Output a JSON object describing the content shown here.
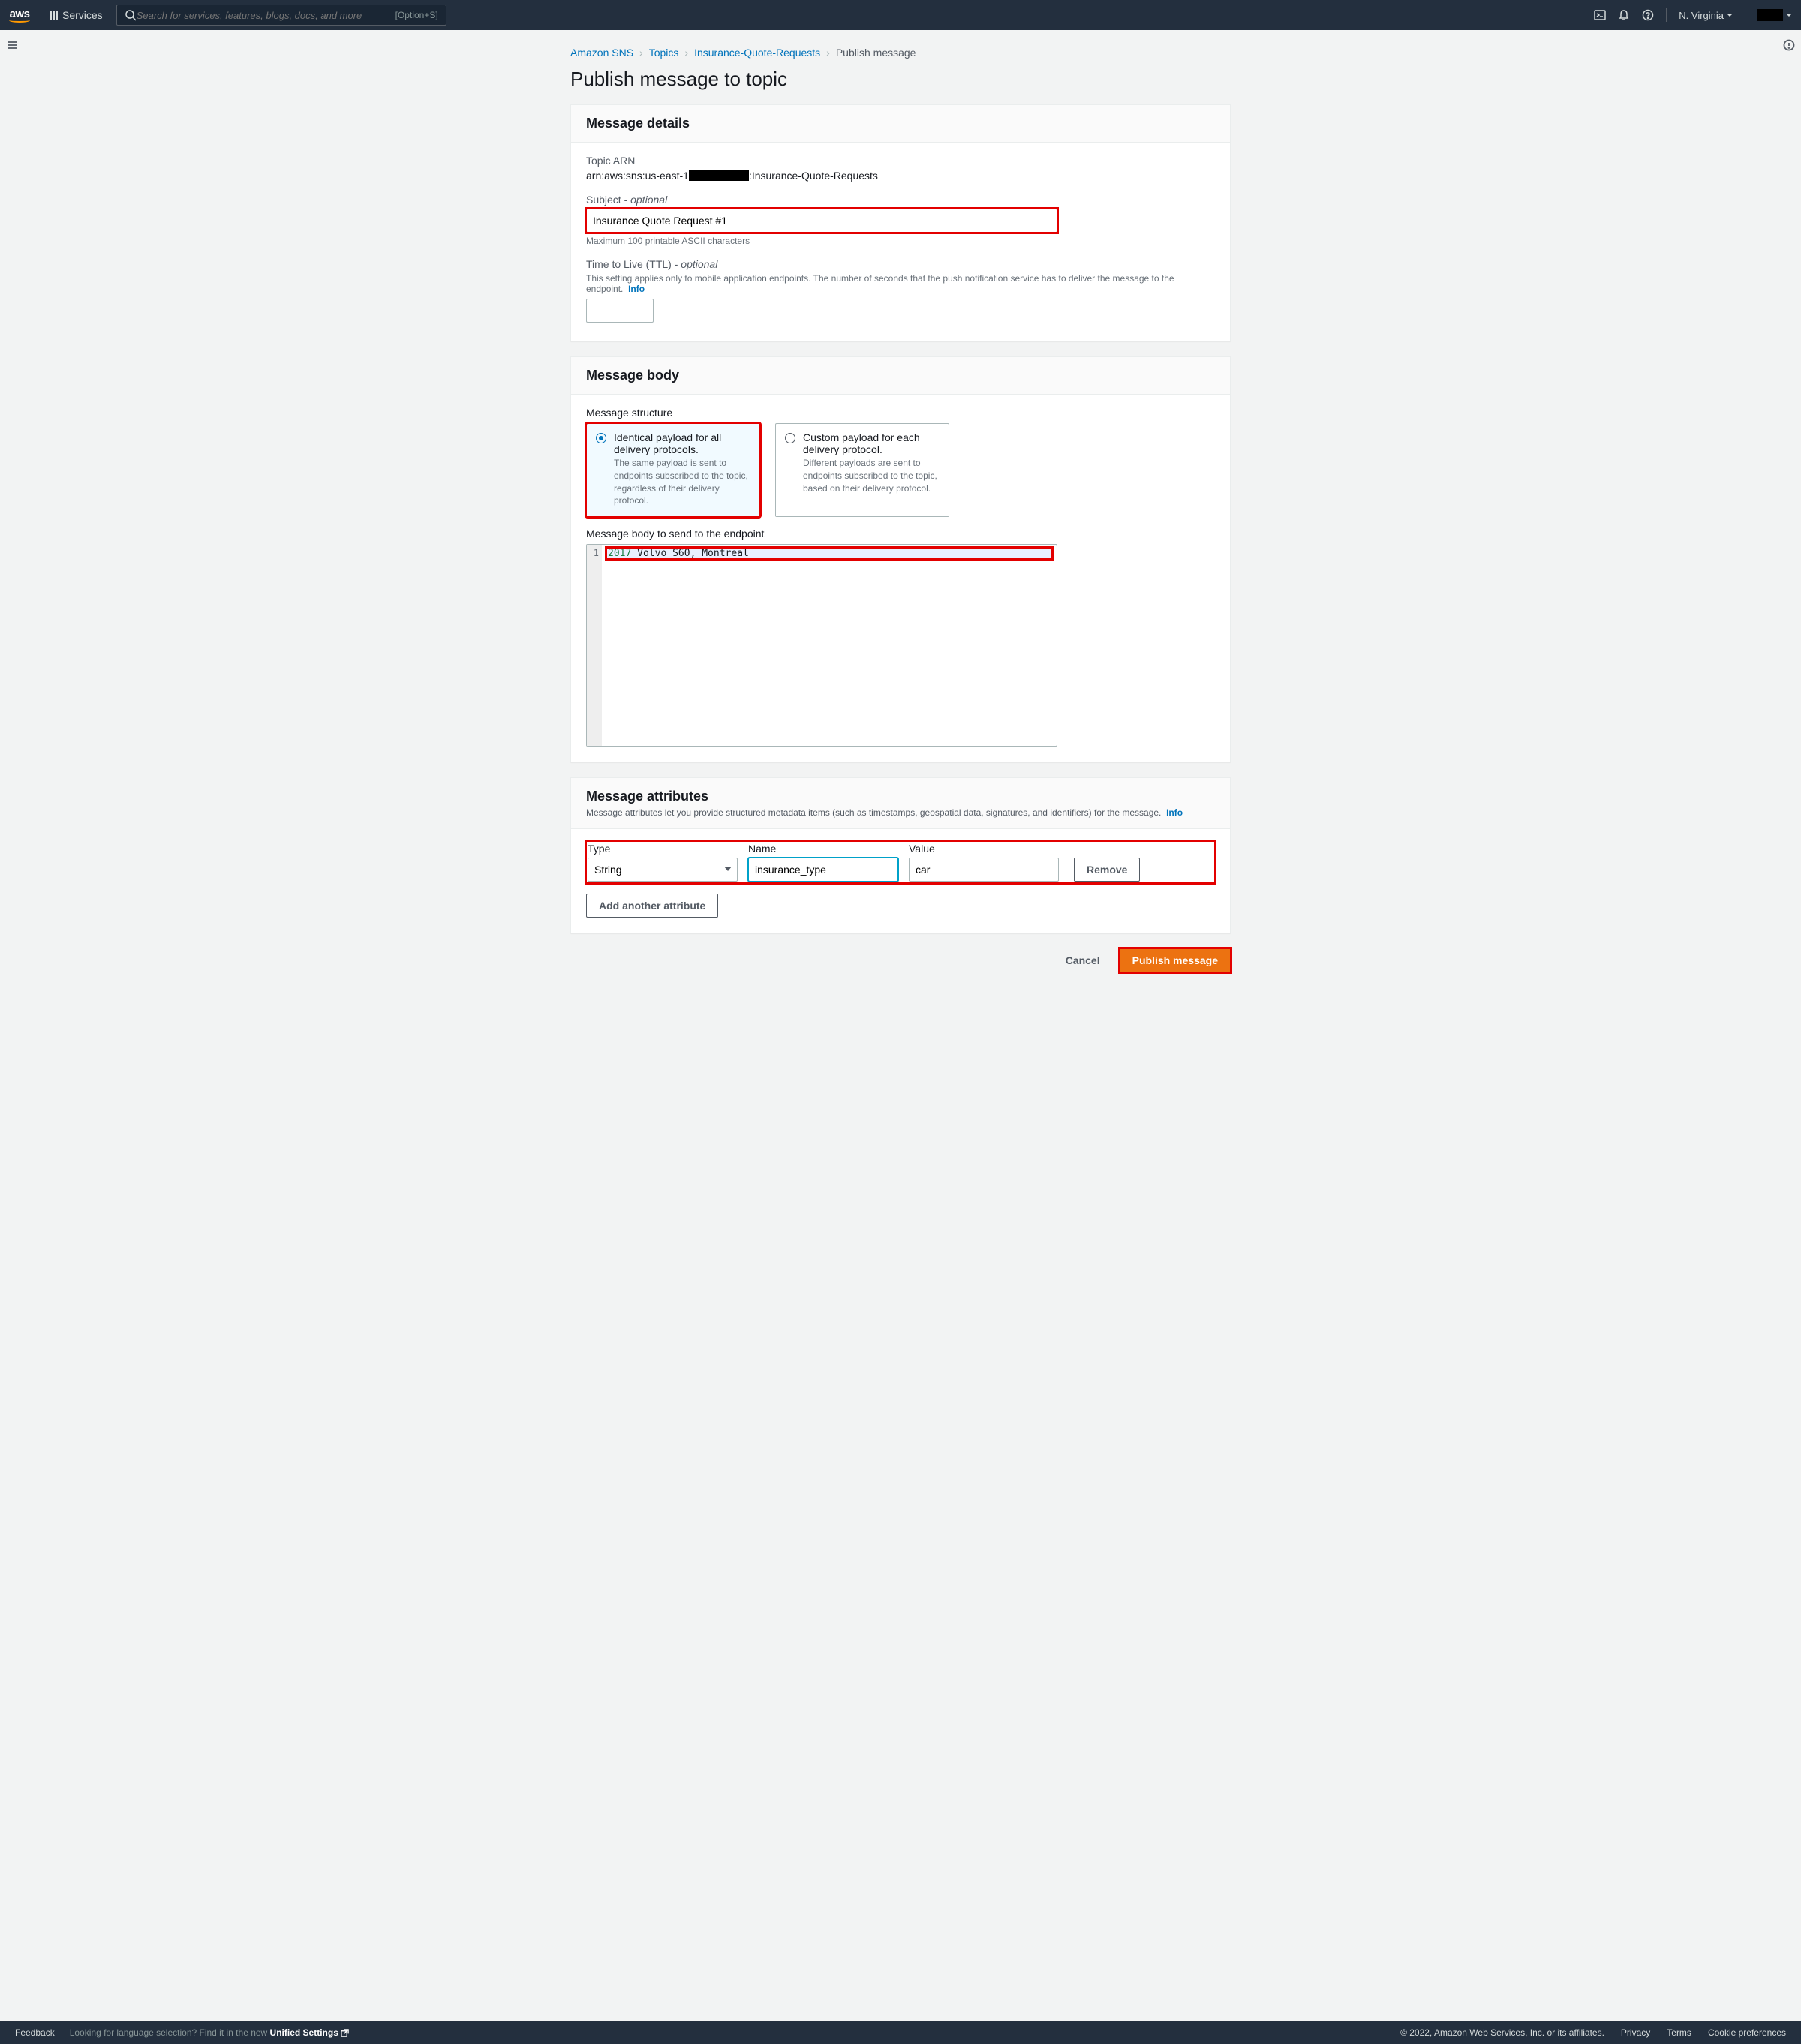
{
  "topnav": {
    "services_label": "Services",
    "search_placeholder": "Search for services, features, blogs, docs, and more",
    "kbd_hint": "[Option+S]",
    "region": "N. Virginia"
  },
  "breadcrumb": {
    "items": [
      "Amazon SNS",
      "Topics",
      "Insurance-Quote-Requests"
    ],
    "current": "Publish message"
  },
  "page_title": "Publish message to topic",
  "details": {
    "heading": "Message details",
    "arn_label": "Topic ARN",
    "arn_prefix": "arn:aws:sns:us-east-1",
    "arn_suffix": ":Insurance-Quote-Requests",
    "subject_label": "Subject - ",
    "subject_optional": "optional",
    "subject_value": "Insurance Quote Request #1",
    "subject_help": "Maximum 100 printable ASCII characters",
    "ttl_label": "Time to Live (TTL) - ",
    "ttl_optional": "optional",
    "ttl_help_text": "This setting applies only to mobile application endpoints. The number of seconds that the push notification service has to deliver the message to the endpoint.",
    "ttl_info": "Info",
    "ttl_value": ""
  },
  "body": {
    "heading": "Message body",
    "structure_label": "Message structure",
    "opt1_title": "Identical payload for all delivery protocols.",
    "opt1_desc": "The same payload is sent to endpoints subscribed to the topic, regardless of their delivery protocol.",
    "opt2_title": "Custom payload for each delivery protocol.",
    "opt2_desc": "Different payloads are sent to endpoints subscribed to the topic, based on their delivery protocol.",
    "editor_label": "Message body to send to the endpoint",
    "editor_line_no": "1",
    "editor_year": "2017",
    "editor_rest": " Volvo S60, Montreal"
  },
  "attrs": {
    "heading": "Message attributes",
    "sub": "Message attributes let you provide structured metadata items (such as timestamps, geospatial data, signatures, and identifiers) for the message.",
    "info": "Info",
    "type_label": "Type",
    "name_label": "Name",
    "value_label": "Value",
    "type_value": "String",
    "name_value": "insurance_type",
    "value_value": "car",
    "remove": "Remove",
    "add": "Add another attribute"
  },
  "actions": {
    "cancel": "Cancel",
    "publish": "Publish message"
  },
  "footer": {
    "feedback": "Feedback",
    "lang_text": "Looking for language selection? Find it in the new ",
    "unified": "Unified Settings",
    "copyright": "© 2022, Amazon Web Services, Inc. or its affiliates.",
    "privacy": "Privacy",
    "terms": "Terms",
    "cookies": "Cookie preferences"
  }
}
